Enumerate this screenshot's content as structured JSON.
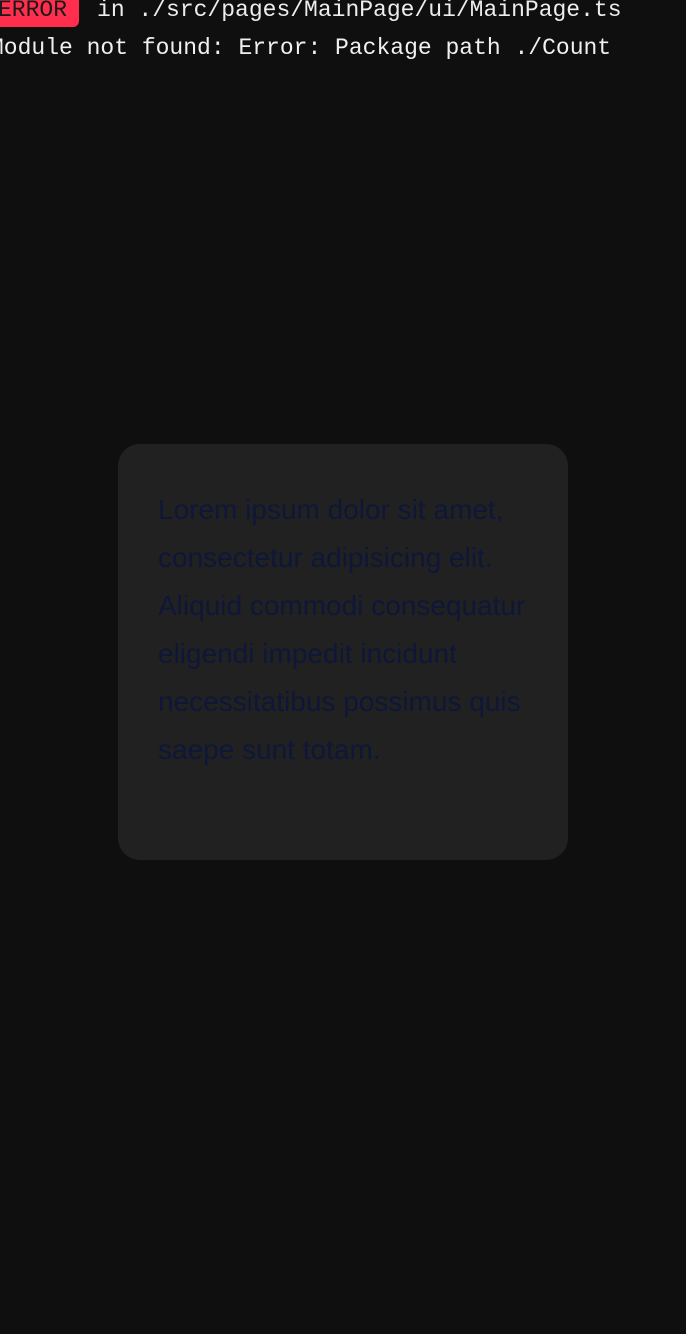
{
  "error_overlay": {
    "badge": "ERROR",
    "location": "in ./src/pages/MainPage/ui/MainPage.ts",
    "message": "Module not found: Error: Package path ./Count"
  },
  "card": {
    "text": "Lorem ipsum dolor sit amet, consectetur adipisicing elit. Aliquid commodi consequatur eligendi impedit incidunt necessitatibus possimus quis saepe sunt totam."
  },
  "colors": {
    "background": "#0f0f0f",
    "card_background": "#212121",
    "card_text": "#0e1738",
    "error_badge": "#ff2e4d"
  }
}
